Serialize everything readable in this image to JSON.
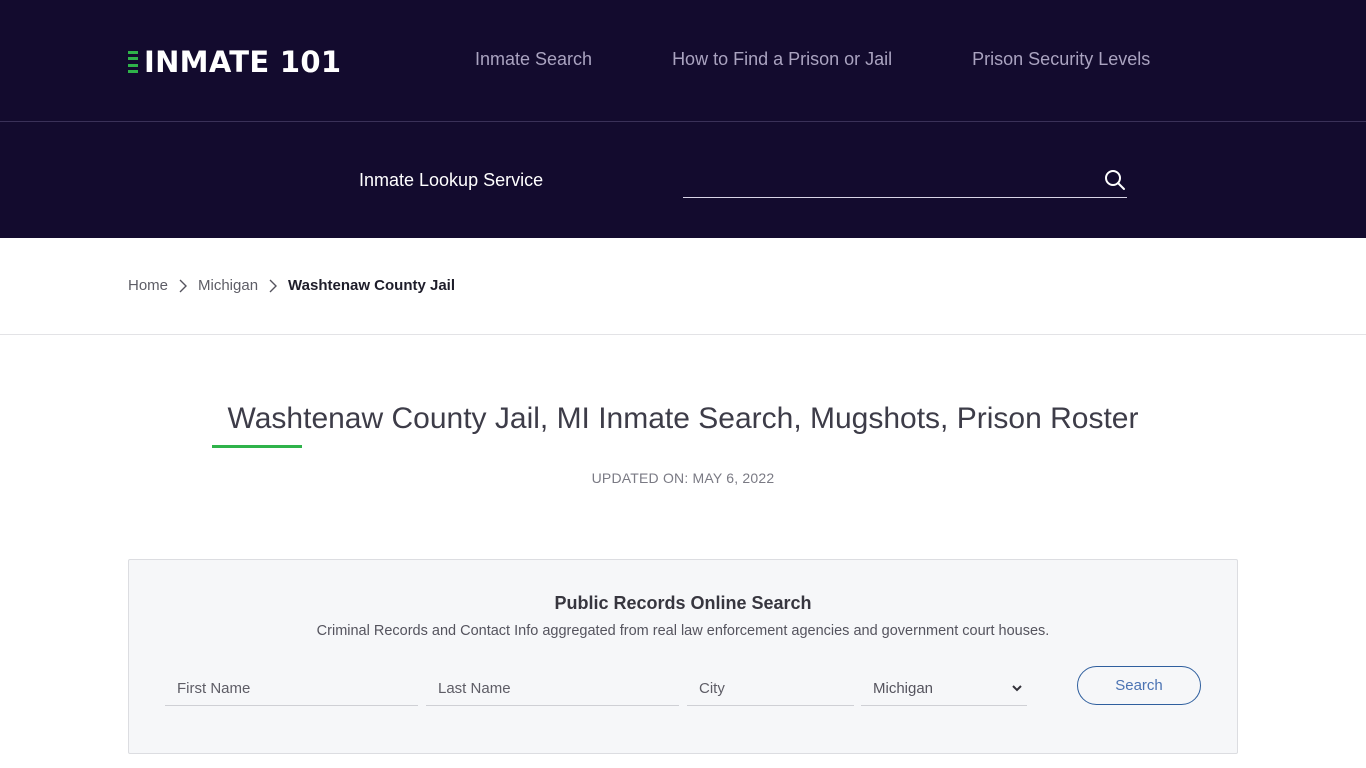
{
  "header": {
    "logo_text": "INMATE 101",
    "nav": [
      {
        "label": "Inmate Search"
      },
      {
        "label": "How to Find a Prison or Jail"
      },
      {
        "label": "Prison Security Levels"
      }
    ],
    "lookup_label": "Inmate Lookup Service",
    "lookup_search": {
      "value": "",
      "placeholder": "",
      "icon": "search-icon"
    }
  },
  "breadcrumb": {
    "items": [
      {
        "label": "Home"
      },
      {
        "label": "Michigan"
      }
    ],
    "current": "Washtenaw County Jail",
    "separator_icon": "chevron-right-icon"
  },
  "main": {
    "title": "Washtenaw County Jail, MI Inmate Search, Mugshots, Prison Roster",
    "updated": "UPDATED ON: MAY 6, 2022"
  },
  "search_card": {
    "title": "Public Records Online Search",
    "subtitle": "Criminal Records and Contact Info aggregated from real law enforcement agencies and government court houses.",
    "first_name": {
      "value": "",
      "placeholder": "First Name"
    },
    "last_name": {
      "value": "",
      "placeholder": "Last Name"
    },
    "city": {
      "value": "",
      "placeholder": "City"
    },
    "state": {
      "selected": "Michigan"
    },
    "button_label": "Search"
  },
  "colors": {
    "header_bg": "#130b2e",
    "accent_green": "#2fb34a",
    "button_blue": "#2f5f9e"
  }
}
